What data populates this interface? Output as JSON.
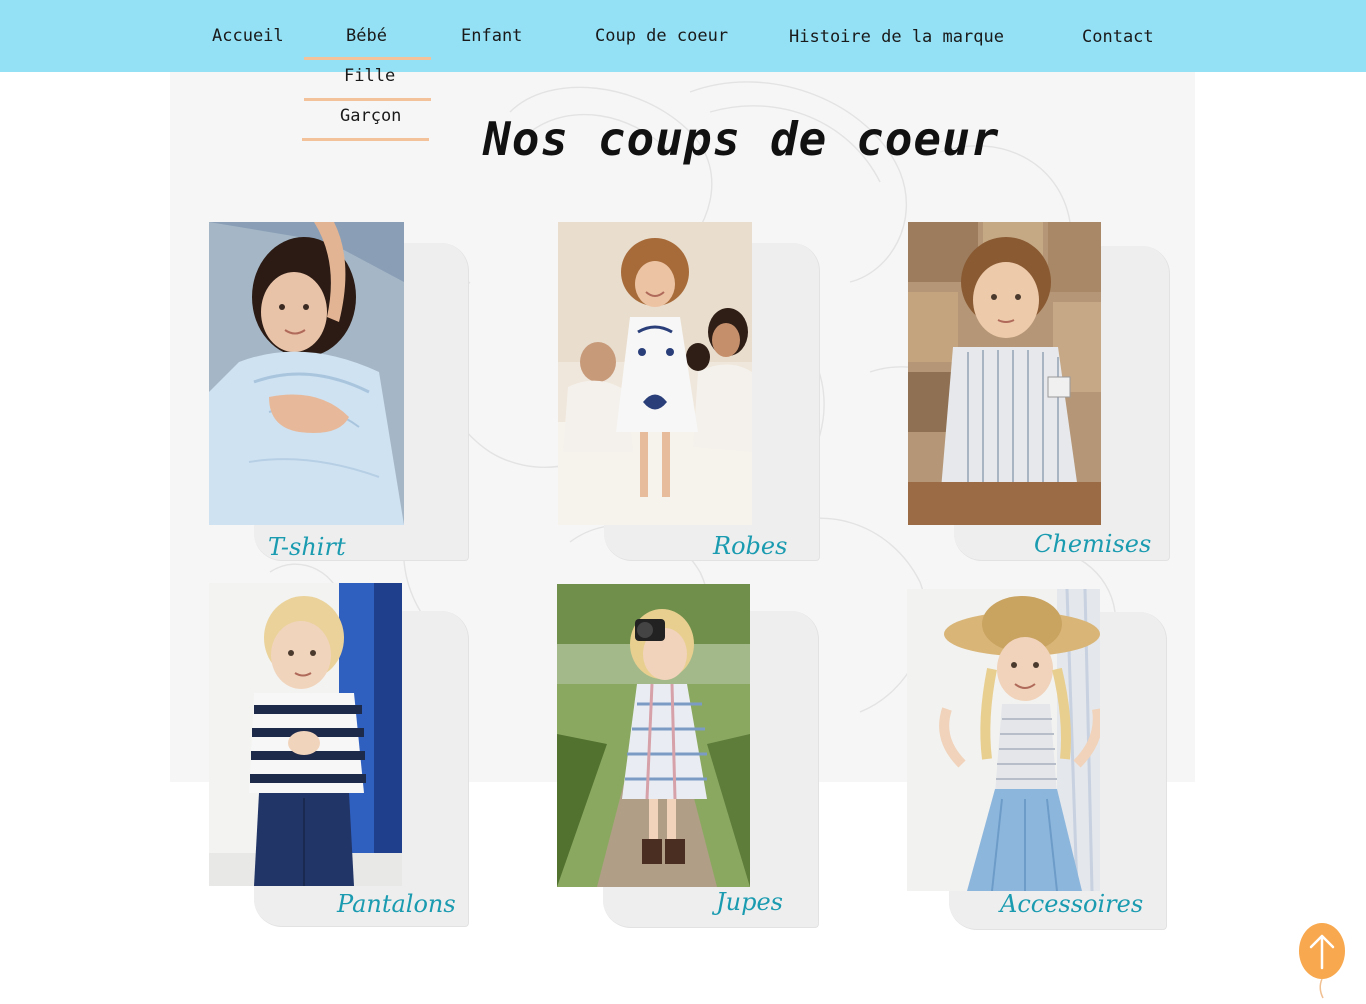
{
  "nav": {
    "items": [
      {
        "label": "Accueil"
      },
      {
        "label": "Bébé"
      },
      {
        "label": "Enfant"
      },
      {
        "label": "Coup de coeur"
      },
      {
        "label": "Histoire de la marque"
      },
      {
        "label": "Contact"
      }
    ],
    "dropdown": [
      {
        "label": "Fille"
      },
      {
        "label": "Garçon"
      }
    ]
  },
  "page": {
    "title": "Nos coups de coeur"
  },
  "cards": [
    {
      "label": "T-shirt",
      "image": "girl-lying-in-blue-dress-photo"
    },
    {
      "label": "Robes",
      "image": "girl-jumping-white-dress-photo"
    },
    {
      "label": "Chemises",
      "image": "boy-striped-shirt-photo"
    },
    {
      "label": "Pantalons",
      "image": "boy-striped-sweater-photo"
    },
    {
      "label": "Jupes",
      "image": "girl-with-camera-plaid-dress-photo"
    },
    {
      "label": "Accessoires",
      "image": "girl-straw-hat-photo"
    }
  ],
  "colors": {
    "header": "#94e1f5",
    "accent_underline": "#f3c29a",
    "label": "#1a9bb0",
    "scroll_button": "#f8a84e"
  },
  "icons": {
    "scroll_top": "arrow-up-icon"
  }
}
